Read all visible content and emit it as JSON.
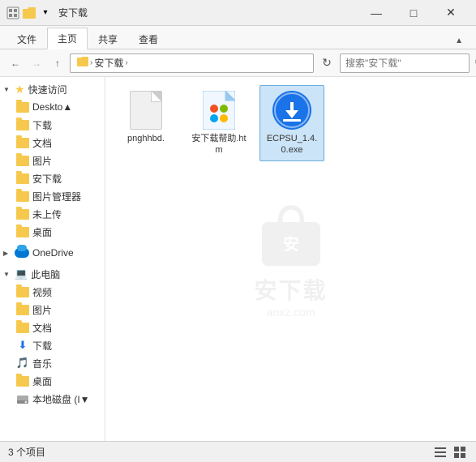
{
  "titleBar": {
    "title": "安下载",
    "controls": {
      "minimize": "—",
      "maximize": "□",
      "close": "✕"
    }
  },
  "ribbon": {
    "tabs": [
      "文件",
      "主页",
      "共享",
      "查看"
    ],
    "activeTab": "主页"
  },
  "addressBar": {
    "backDisabled": false,
    "forwardDisabled": true,
    "upDisabled": false,
    "breadcrumb": [
      "安下载"
    ],
    "searchPlaceholder": "搜索\"安下载\""
  },
  "sidebar": {
    "quickAccess": {
      "label": "快速访问",
      "items": [
        {
          "label": "Deskto▲",
          "type": "folder"
        },
        {
          "label": "下载",
          "type": "folder",
          "pinned": true
        },
        {
          "label": "文档",
          "type": "folder",
          "pinned": true
        },
        {
          "label": "图片",
          "type": "folder",
          "pinned": true
        },
        {
          "label": "安下载",
          "type": "folder",
          "pinned": true
        },
        {
          "label": "图片管理器",
          "type": "folder",
          "pinned": true
        },
        {
          "label": "未上传",
          "type": "folder",
          "pinned": true
        },
        {
          "label": "桌面",
          "type": "folder",
          "pinned": true
        }
      ]
    },
    "oneDrive": {
      "label": "OneDrive"
    },
    "thisPC": {
      "label": "此电脑",
      "items": [
        {
          "label": "视频",
          "type": "folder"
        },
        {
          "label": "图片",
          "type": "folder"
        },
        {
          "label": "文档",
          "type": "folder"
        },
        {
          "label": "下载",
          "type": "folder",
          "special": "download"
        },
        {
          "label": "音乐",
          "type": "folder",
          "special": "music"
        },
        {
          "label": "桌面",
          "type": "folder"
        },
        {
          "label": "本地磁盘 (I▼",
          "type": "drive"
        }
      ]
    }
  },
  "files": [
    {
      "name": "pnghhbd.",
      "type": "generic",
      "selected": false
    },
    {
      "name": "安下载帮助.htm",
      "type": "htm",
      "selected": false
    },
    {
      "name": "ECPSU_1.4.0.exe",
      "type": "exe",
      "selected": true
    }
  ],
  "statusBar": {
    "count": "3 个项目",
    "selectedInfo": ""
  },
  "watermark": {
    "text1": "安下载",
    "text2": "anxz.com"
  }
}
